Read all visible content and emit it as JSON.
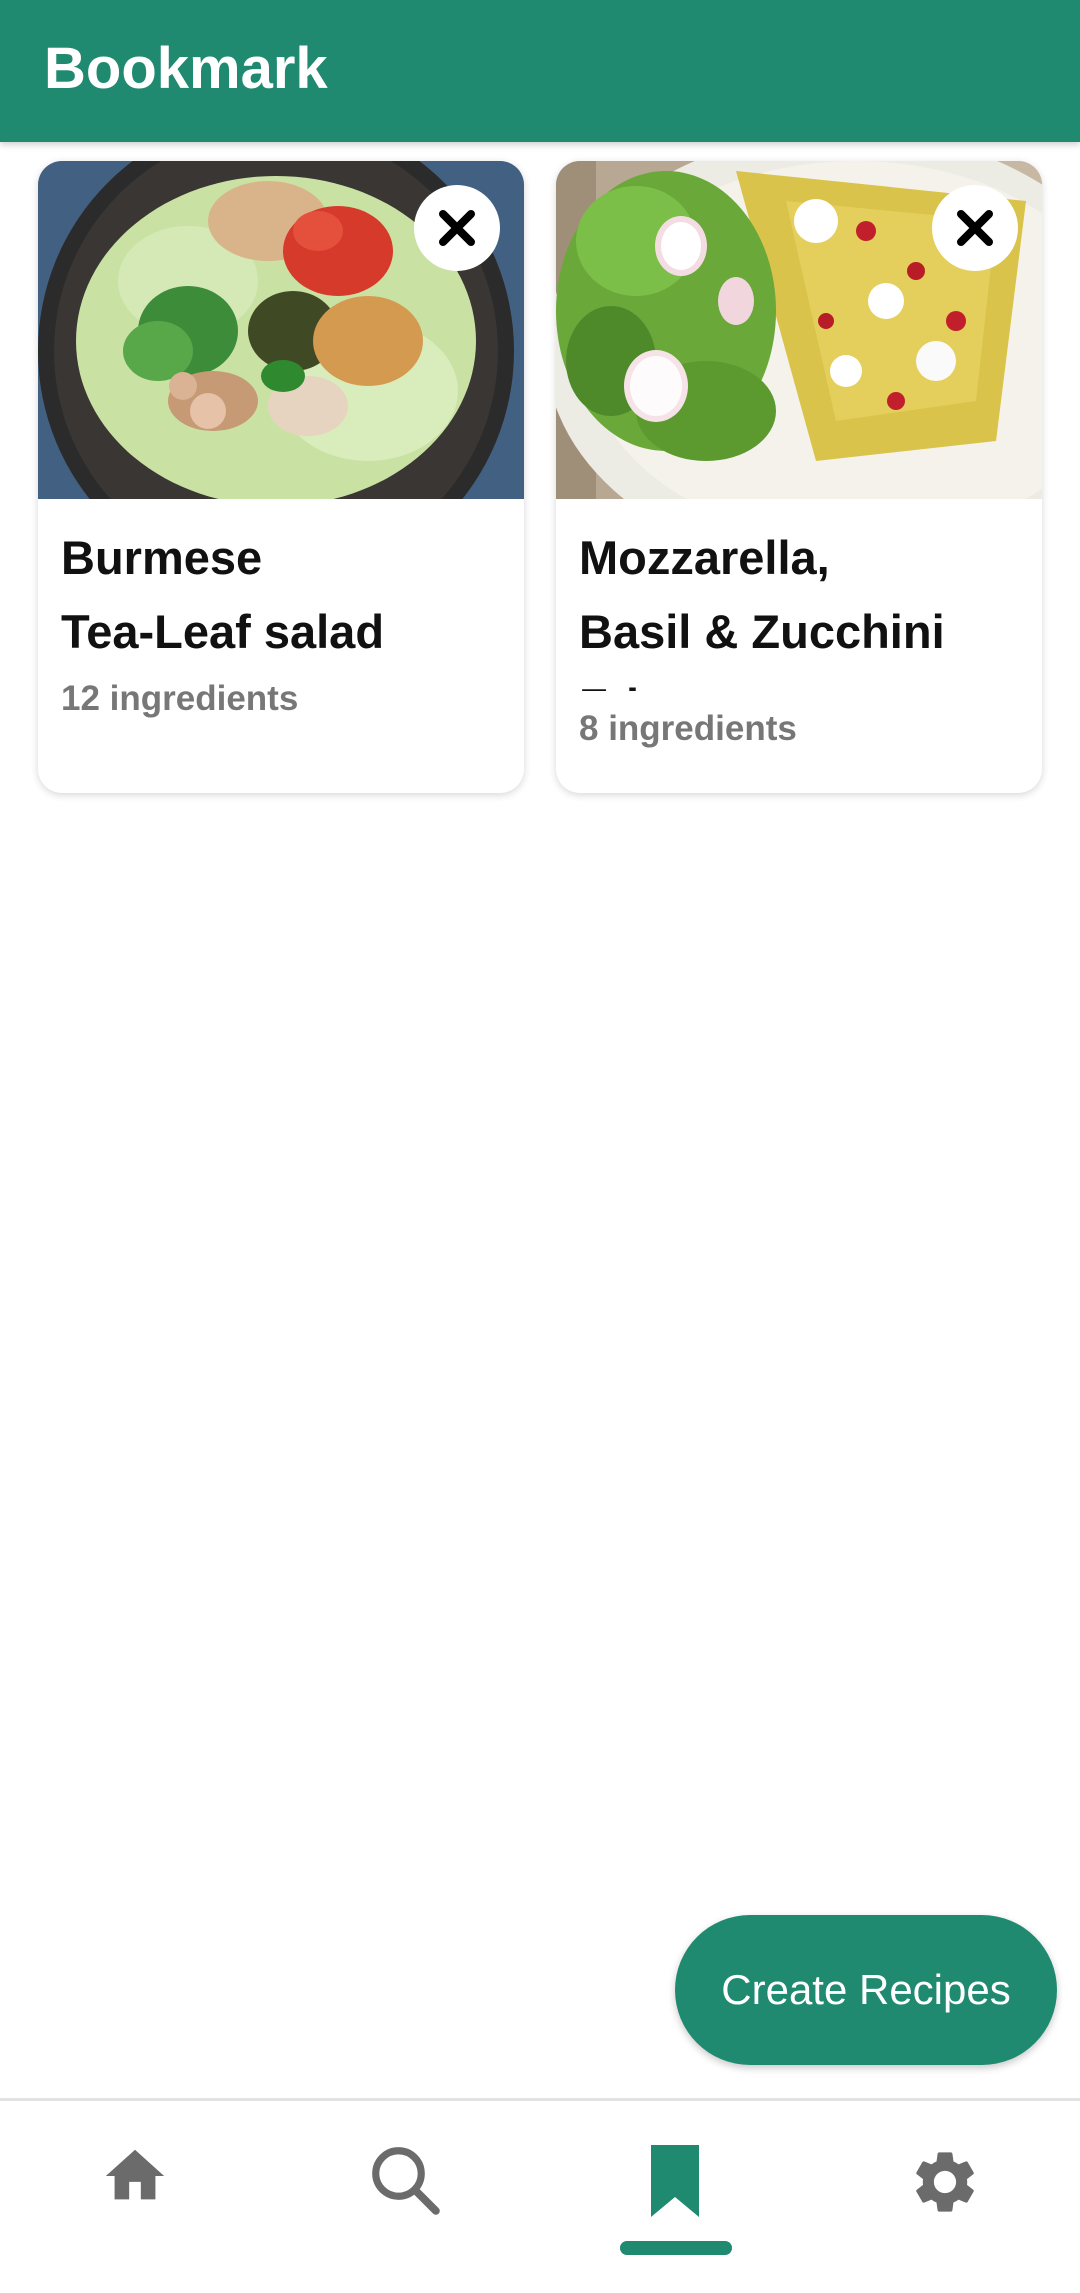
{
  "header": {
    "title": "Bookmark"
  },
  "colors": {
    "primary": "#1f8a70",
    "icon_inactive": "#6b6b6b",
    "subtitle": "#777777"
  },
  "bookmarks": [
    {
      "title_line1": "Burmese",
      "title_line2": "Tea-Leaf salad",
      "ingredients": "12 ingredients",
      "image": "tea-leaf-salad-photo",
      "remove_icon": "close-icon"
    },
    {
      "title_line1": "Mozzarella,",
      "title_line2": "Basil & Zucchini",
      "title_line3": "Frittata",
      "ingredients": "8 ingredients",
      "image": "frittata-salad-photo",
      "remove_icon": "close-icon"
    }
  ],
  "fab": {
    "label": "Create Recipes"
  },
  "bottom_nav": {
    "items": [
      {
        "name": "home",
        "icon": "home-icon",
        "active": false
      },
      {
        "name": "search",
        "icon": "search-icon",
        "active": false
      },
      {
        "name": "bookmark",
        "icon": "bookmark-icon",
        "active": true
      },
      {
        "name": "settings",
        "icon": "gear-icon",
        "active": false
      }
    ]
  }
}
